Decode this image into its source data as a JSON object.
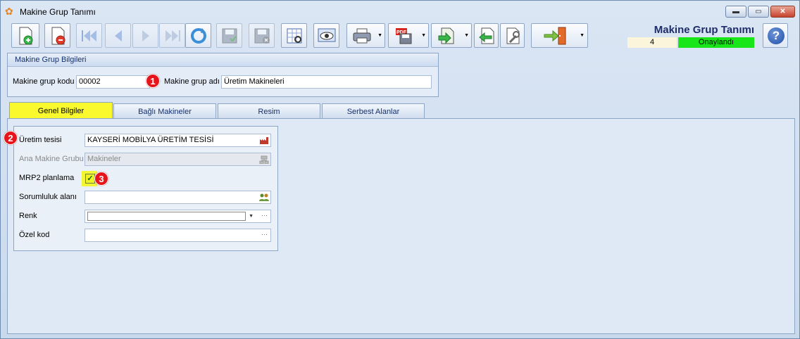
{
  "window": {
    "title": "Makine Grup Tanımı",
    "min_label": "▬",
    "max_label": "▭",
    "close_label": "✕"
  },
  "header": {
    "title": "Makine Grup Tanımı",
    "record_no": "4",
    "status": "Onaylandı",
    "help_label": "?"
  },
  "toolbar": {
    "buttons": [
      "new-icon",
      "delete-icon",
      "first-icon",
      "prev-icon",
      "next-icon",
      "last-icon",
      "refresh-icon",
      "save-icon",
      "save-close-icon",
      "form-design-icon",
      "preview-icon",
      "print-icon",
      "pdf-icon",
      "export-icon",
      "back-icon",
      "settings-icon",
      "exit-icon"
    ]
  },
  "group": {
    "title": "Makine Grup Bilgileri",
    "code_label": "Makine grup kodu",
    "code_value": "00002",
    "name_label": "Makine grup adı",
    "name_value": "Üretim Makineleri"
  },
  "tabs": [
    "Genel Bilgiler",
    "Bağlı Makineler",
    "Resim",
    "Serbest Alanlar"
  ],
  "form": {
    "facility_label": "Üretim tesisi",
    "facility_value": "KAYSERİ MOBİLYA ÜRETİM TESİSİ",
    "parent_label": "Ana Makine Grubu",
    "parent_value": "Makineler",
    "mrp_label": "MRP2 planlama",
    "mrp_checked": true,
    "mrp_mark": "✓",
    "resp_label": "Sorumluluk alanı",
    "resp_value": "",
    "color_label": "Renk",
    "color_value": "",
    "special_label": "Özel kod",
    "special_value": ""
  },
  "annotations": [
    "1",
    "2",
    "3"
  ],
  "colors": {
    "status_green": "#19e619",
    "active_tab": "#f9f92e",
    "badge_red": "#e8141b",
    "title_navy": "#1e2c6b"
  }
}
